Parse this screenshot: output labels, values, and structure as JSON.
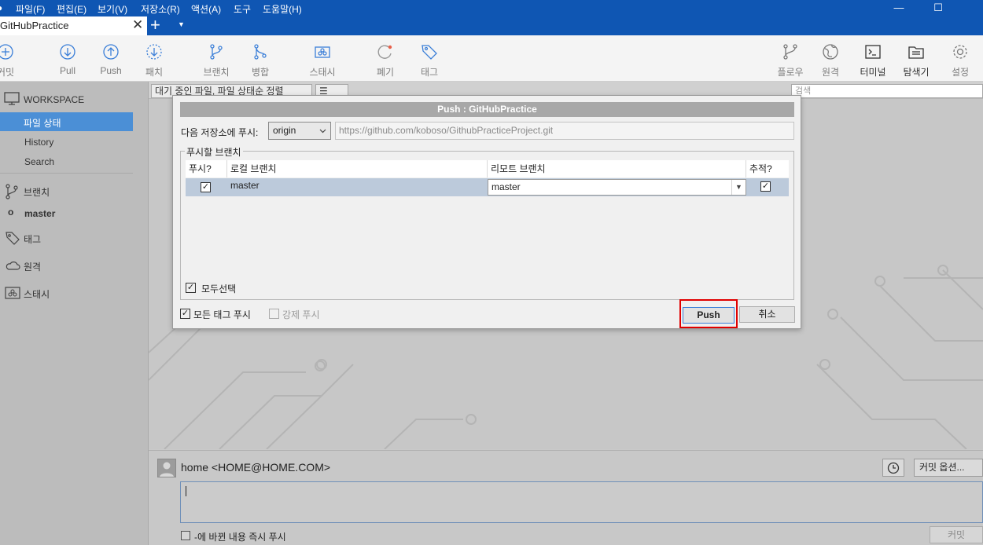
{
  "menubar": {
    "items": [
      "파일(F)",
      "편집(E)",
      "보기(V)",
      "저장소(R)",
      "액션(A)",
      "도구",
      "도움말(H)"
    ],
    "window_controls": [
      "—",
      "☐"
    ]
  },
  "tabs": {
    "title": "GitHubPractice",
    "close": "✕",
    "add": "+",
    "more": "▼"
  },
  "toolbar": {
    "left": [
      "커밋",
      "Pull",
      "Push",
      "패치",
      "브랜치",
      "병합",
      "스태시",
      "폐기",
      "태그"
    ],
    "right": [
      "플로우",
      "원격",
      "터미널",
      "탐색기",
      "설정"
    ]
  },
  "sidebar": {
    "workspace": "WORKSPACE",
    "file_status": "파일 상태",
    "history": "History",
    "search": "Search",
    "branches": "브랜치",
    "current_branch": "master",
    "tags": "태그",
    "remotes": "원격",
    "stashes": "스태시"
  },
  "filterbar": {
    "pending_sort": "대기 중인 파일, 파일 상태순 정렬",
    "view_mode": "☰",
    "search_placeholder": "검색"
  },
  "commit": {
    "author": "home <HOME@HOME.COM>",
    "options": "커밋 옵션...",
    "push_now": "-에 바뀐 내용 즉시 푸시",
    "commit_button": "커밋"
  },
  "dialog": {
    "title": "Push :  GitHubPractice",
    "remote_label": "다음 저장소에 푸시:",
    "remote_value": "origin",
    "remote_url": "https://github.com/koboso/GithubPracticeProject.git",
    "group_label": "푸시할 브랜치",
    "columns": {
      "push": "푸시?",
      "local": "로컬 브랜치",
      "remote": "리모트 브랜치",
      "track": "추적?"
    },
    "row": {
      "local": "master",
      "remote": "master",
      "push_checked": true,
      "track_checked": true
    },
    "select_all": "모두선택",
    "push_all_tags": "모든 태그 푸시",
    "force_push": "강제 푸시",
    "push_button": "Push",
    "cancel_button": "취소"
  },
  "colors": {
    "titlebar": "#0f56b3",
    "selection": "#4b8fd6",
    "highlight_box": "#e00000",
    "row_selected": "#bccadb"
  }
}
